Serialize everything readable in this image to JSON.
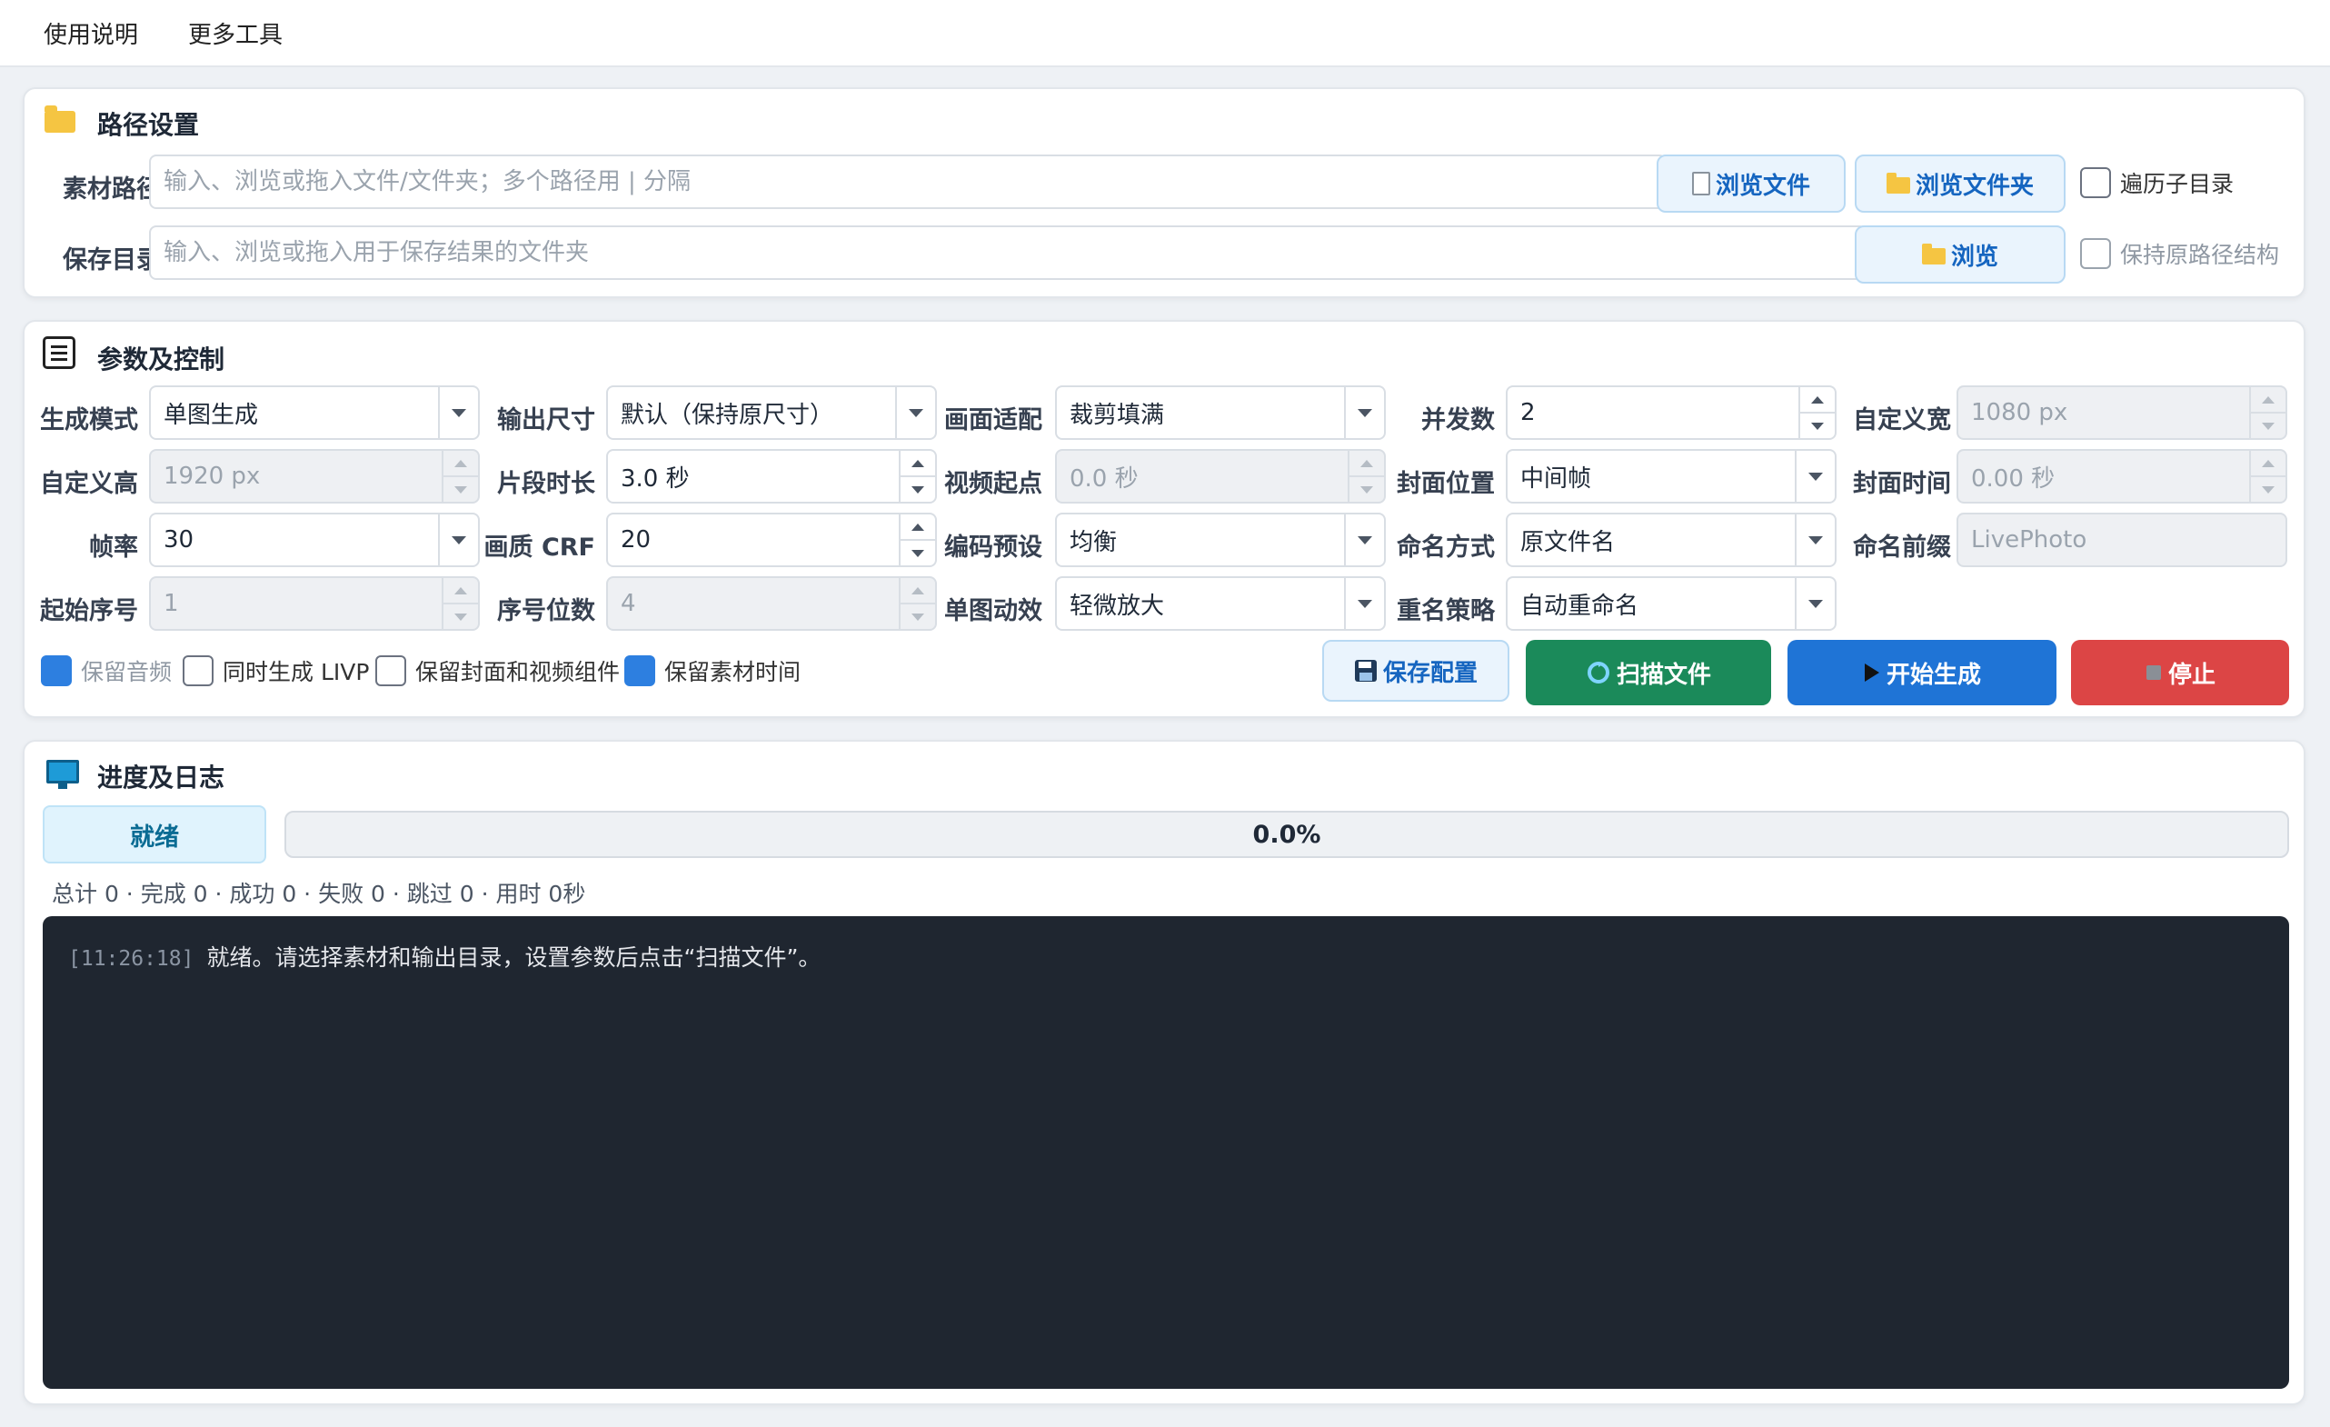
{
  "menu": {
    "items": [
      "使用说明",
      "更多工具"
    ]
  },
  "path_section": {
    "title": "路径设置",
    "source_label": "素材路径",
    "source_placeholder": "输入、浏览或拖入文件/文件夹；多个路径用 | 分隔",
    "browse_file": "浏览文件",
    "browse_folder": "浏览文件夹",
    "recurse_label": "遍历子目录",
    "save_label": "保存目录",
    "save_placeholder": "输入、浏览或拖入用于保存结果的文件夹",
    "browse": "浏览",
    "keep_structure_label": "保持原路径结构"
  },
  "params_section": {
    "title": "参数及控制",
    "gen_mode": {
      "label": "生成模式",
      "value": "单图生成"
    },
    "output_size": {
      "label": "输出尺寸",
      "value": "默认（保持原尺寸）"
    },
    "fit": {
      "label": "画面适配",
      "value": "裁剪填满"
    },
    "concurrency": {
      "label": "并发数",
      "value": "2"
    },
    "custom_width": {
      "label": "自定义宽",
      "value": "1080 px"
    },
    "custom_height": {
      "label": "自定义高",
      "value": "1920 px"
    },
    "segment_duration": {
      "label": "片段时长",
      "value": "3.0 秒"
    },
    "video_start": {
      "label": "视频起点",
      "value": "0.0 秒"
    },
    "cover_position": {
      "label": "封面位置",
      "value": "中间帧"
    },
    "cover_time": {
      "label": "封面时间",
      "value": "0.00 秒"
    },
    "frame_rate": {
      "label": "帧率",
      "value": "30"
    },
    "crf": {
      "label": "画质 CRF",
      "value": "20"
    },
    "encode_preset": {
      "label": "编码预设",
      "value": "均衡"
    },
    "naming": {
      "label": "命名方式",
      "value": "原文件名"
    },
    "name_prefix": {
      "label": "命名前缀",
      "value": "LivePhoto"
    },
    "start_index": {
      "label": "起始序号",
      "value": "1"
    },
    "index_digits": {
      "label": "序号位数",
      "value": "4"
    },
    "single_effect": {
      "label": "单图动效",
      "value": "轻微放大"
    },
    "rename_policy": {
      "label": "重名策略",
      "value": "自动重命名"
    },
    "checks": {
      "keep_audio": "保留音频",
      "gen_livp": "同时生成 LIVP",
      "keep_components": "保留封面和视频组件",
      "keep_time": "保留素材时间"
    },
    "buttons": {
      "save_config": "保存配置",
      "scan": "扫描文件",
      "start": "开始生成",
      "stop": "停止"
    }
  },
  "progress_section": {
    "title": "进度及日志",
    "status": "就绪",
    "progress_text": "0.0%",
    "progress_fraction": 0.0,
    "stats": "总计 0 · 完成 0 · 成功 0 · 失败 0 · 跳过 0 · 用时 0秒",
    "log": [
      {
        "time": "[11:26:18]",
        "text": "就绪。请选择素材和输出目录，设置参数后点击“扫描文件”。"
      }
    ]
  },
  "colors": {
    "accent_blue": "#1f74d6",
    "scan_green": "#1b8a5a",
    "stop_red": "#dc4545",
    "log_bg": "#1f2630"
  }
}
